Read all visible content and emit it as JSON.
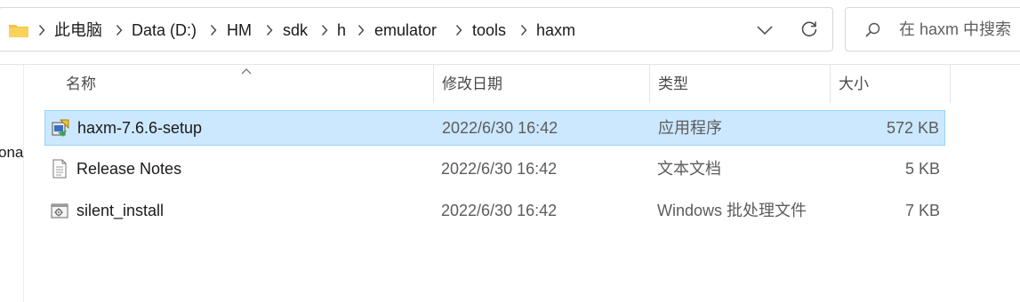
{
  "address_bar": {
    "path": [
      "此电脑",
      "Data (D:)",
      "HM",
      "sdk",
      "h",
      "emulator",
      "tools",
      "haxm"
    ]
  },
  "search": {
    "placeholder": "在 haxm 中搜索"
  },
  "nav_fragment": "ona",
  "columns": {
    "name": "名称",
    "date": "修改日期",
    "type": "类型",
    "size": "大小"
  },
  "files": [
    {
      "name": "haxm-7.6.6-setup",
      "date": "2022/6/30 16:42",
      "type": "应用程序",
      "size": "572 KB",
      "icon": "installer-icon",
      "selected": true
    },
    {
      "name": "Release Notes",
      "date": "2022/6/30 16:42",
      "type": "文本文档",
      "size": "5 KB",
      "icon": "text-document-icon",
      "selected": false
    },
    {
      "name": "silent_install",
      "date": "2022/6/30 16:42",
      "type": "Windows 批处理文件",
      "size": "7 KB",
      "icon": "batch-file-icon",
      "selected": false
    }
  ],
  "colors": {
    "selection_bg": "#cce8ff",
    "selection_border": "#99d1ff",
    "folder": "#f5c242"
  }
}
